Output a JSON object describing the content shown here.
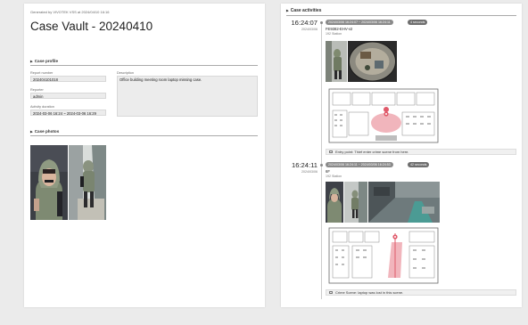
{
  "report": {
    "generated_by": "Generated by VIVOTEK VSS at 2024/04/10 16:16",
    "title": "Case Vault - 20240410"
  },
  "case_profile": {
    "heading": "Case profile",
    "report_number_label": "Report number",
    "report_number": "202404101018",
    "reporter_label": "Reporter",
    "reporter": "admin",
    "activity_duration_label": "Activity duration",
    "activity_duration": "2024-03-06 16:24 ~ 2024-03-06 16:29",
    "description_label": "Description",
    "description": "Office building meeting room laptop missing case."
  },
  "case_photos": {
    "heading": "Case photos"
  },
  "case_activities": {
    "heading": "Case activities",
    "items": [
      {
        "time": "16:24:07",
        "date": "2024/03/06",
        "range": "2024/03/06 16:24:07 ~ 2024/03/06 16:24:11",
        "duration": "4 seconds",
        "camera": "FE9382-EHV-v2",
        "station": "192 Station",
        "note": "Entry point: Thief enter crime scene from here."
      },
      {
        "time": "16:24:11",
        "date": "2024/03/06",
        "range": "2024/03/06 16:24:11 ~ 2024/03/06 16:24:53",
        "duration": "42 seconds",
        "camera": "6F",
        "station": "192 Station",
        "note": "Crime Scene: laptop was lost in this scene."
      }
    ]
  },
  "colors": {
    "background": "#ebebeb",
    "pill": "#8a8a8a",
    "marker": "#e05a6a"
  }
}
